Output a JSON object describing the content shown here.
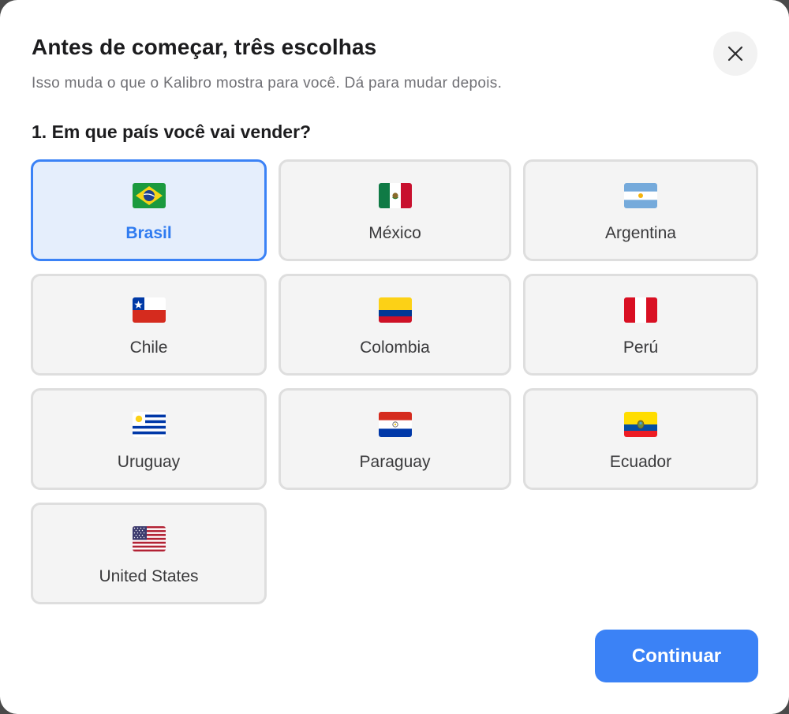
{
  "dialog": {
    "title": "Antes de começar, três escolhas",
    "subtitle": "Isso muda o que o Kalibro mostra para você. Dá para mudar depois.",
    "close_icon": "close-icon"
  },
  "question": {
    "label": "1. Em que país você vai vender?"
  },
  "countries": [
    {
      "label": "Brasil",
      "flag_icon": "brazil-flag-icon",
      "selected": true
    },
    {
      "label": "México",
      "flag_icon": "mexico-flag-icon",
      "selected": false
    },
    {
      "label": "Argentina",
      "flag_icon": "argentina-flag-icon",
      "selected": false
    },
    {
      "label": "Chile",
      "flag_icon": "chile-flag-icon",
      "selected": false
    },
    {
      "label": "Colombia",
      "flag_icon": "colombia-flag-icon",
      "selected": false
    },
    {
      "label": "Perú",
      "flag_icon": "peru-flag-icon",
      "selected": false
    },
    {
      "label": "Uruguay",
      "flag_icon": "uruguay-flag-icon",
      "selected": false
    },
    {
      "label": "Paraguay",
      "flag_icon": "paraguay-flag-icon",
      "selected": false
    },
    {
      "label": "Ecuador",
      "flag_icon": "ecuador-flag-icon",
      "selected": false
    },
    {
      "label": "United States",
      "flag_icon": "usa-flag-icon",
      "selected": false
    }
  ],
  "footer": {
    "continue_label": "Continuar"
  },
  "colors": {
    "accent": "#3b82f6",
    "selected_background": "#e5eefc",
    "card_background": "#f4f4f4",
    "card_border": "#dedede"
  }
}
